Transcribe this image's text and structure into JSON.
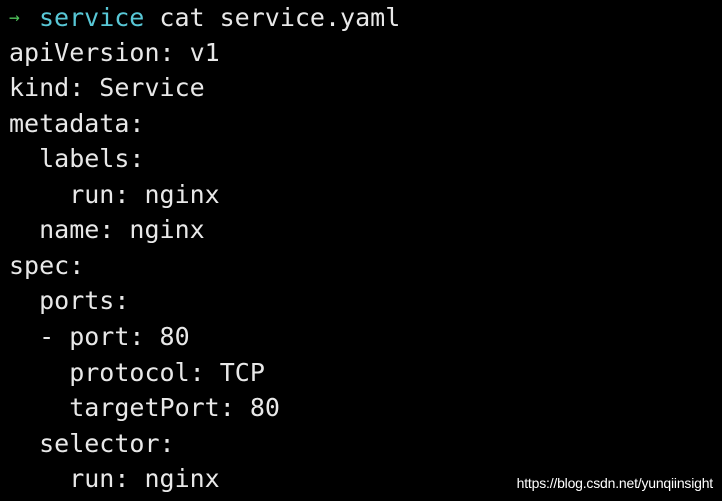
{
  "terminal": {
    "prompt": {
      "arrow": "→",
      "directory": "service",
      "command": "cat service.yaml"
    },
    "output_lines": [
      "apiVersion: v1",
      "kind: Service",
      "metadata:",
      "  labels:",
      "    run: nginx",
      "  name: nginx",
      "spec:",
      "  ports:",
      "  - port: 80",
      "    protocol: TCP",
      "    targetPort: 80",
      "  selector:",
      "    run: nginx"
    ]
  },
  "watermark": "https://blog.csdn.net/yunqiinsight",
  "colors": {
    "background": "#000000",
    "text": "#e8e8e8",
    "prompt_arrow": "#4fc35a",
    "prompt_directory": "#58c7d6"
  }
}
